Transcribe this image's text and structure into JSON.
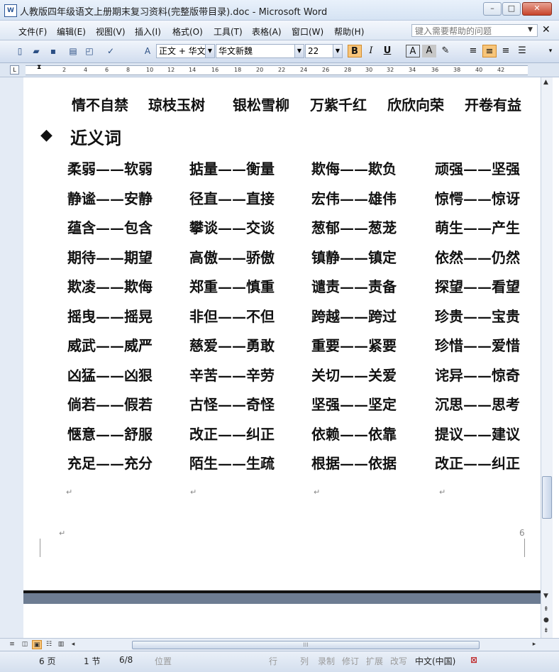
{
  "window": {
    "title": "人教版四年级语文上册期末复习资料(完整版带目录).doc - Microsoft Word",
    "icon_glyph": "W",
    "minimize": "–",
    "maximize": "□",
    "close": "✕"
  },
  "menu": {
    "items": [
      "文件(F)",
      "编辑(E)",
      "视图(V)",
      "插入(I)",
      "格式(O)",
      "工具(T)",
      "表格(A)",
      "窗口(W)",
      "帮助(H)"
    ],
    "help_placeholder": "键入需要帮助的问题",
    "dropdown_glyph": "▼",
    "doc_close": "✕"
  },
  "toolbar": {
    "style": "正文 + 华文",
    "font": "华文新魏",
    "size": "22",
    "bold": "B",
    "italic": "I",
    "underline": "U",
    "char_border": "A",
    "char_shading": "A"
  },
  "ruler": {
    "tab_glyph": "L",
    "numbers": [
      "2",
      "4",
      "6",
      "8",
      "10",
      "12",
      "14",
      "16",
      "18",
      "20",
      "22",
      "24",
      "26",
      "28",
      "30",
      "32",
      "34",
      "36",
      "38",
      "40",
      "42"
    ]
  },
  "document": {
    "idiom_row": [
      "情不自禁",
      "琼枝玉树",
      "银松雪柳",
      "万紫千红",
      "欣欣向荣",
      "开卷有益"
    ],
    "section_bullet": "◆",
    "section_title": "近义词",
    "para_mark": "↵",
    "synonym_rows": [
      [
        "柔弱——软弱",
        "掂量——衡量",
        "欺侮——欺负",
        "顽强——坚强"
      ],
      [
        "静谧——安静",
        "径直——直接",
        "宏伟——雄伟",
        "惊愕——惊讶"
      ],
      [
        "蕴含——包含",
        "攀谈——交谈",
        "葱郁——葱茏",
        "萌生——产生"
      ],
      [
        "期待——期望",
        "高傲——骄傲",
        "镇静——镇定",
        "依然——仍然"
      ],
      [
        "欺凌——欺侮",
        "郑重——慎重",
        "谴责——责备",
        "探望——看望"
      ],
      [
        "摇曳——摇晃",
        "非但——不但",
        "跨越——跨过",
        "珍贵——宝贵"
      ],
      [
        "威武——威严",
        "慈爱——勇敢",
        "重要——紧要",
        "珍惜——爱惜"
      ],
      [
        "凶猛——凶狠",
        "辛苦——辛劳",
        "关切——关爱",
        "诧异——惊奇"
      ],
      [
        "倘若——假若",
        "古怪——奇怪",
        "坚强——坚定",
        "沉思——思考"
      ],
      [
        "惬意——舒服",
        "改正——纠正",
        "依赖——依靠",
        "提议——建议"
      ],
      [
        "充足——充分",
        "陌生——生疏",
        "根据——依据",
        "改正——纠正"
      ]
    ],
    "page_number": "6"
  },
  "statusbar": {
    "page": "6 页",
    "section": "1 节",
    "page_of": "6/8",
    "position": "位置",
    "line": "行",
    "column": "列",
    "rec": "录制",
    "trk": "修订",
    "ext": "扩展",
    "ovr": "改写",
    "language": "中文(中国)"
  }
}
